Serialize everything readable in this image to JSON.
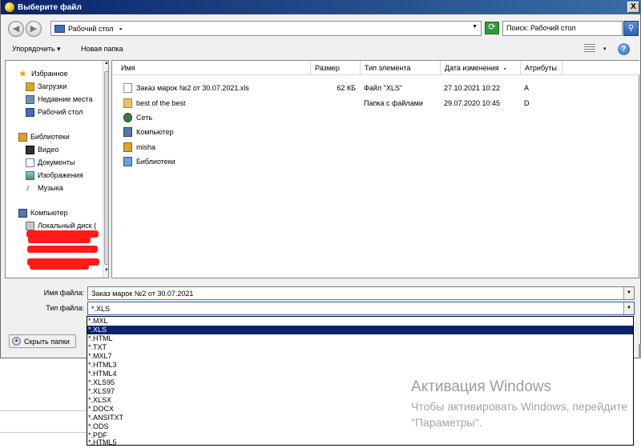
{
  "window": {
    "title": "Выберите файл",
    "close_label": "X"
  },
  "address": {
    "location": "Рабочий стол",
    "arrow": "▸",
    "search_placeholder": "Поиск: Рабочий стол"
  },
  "toolbar": {
    "organize_label": "Упорядочить ▾",
    "new_folder_label": "Новая папка",
    "view_drop": "▾",
    "help": "?"
  },
  "nav": {
    "favorites": "Избранное",
    "downloads": "Загрузки",
    "recent": "Недавние места",
    "desktop": "Рабочий стол",
    "libraries": "Библиотеки",
    "video": "Видео",
    "documents": "Документы",
    "images": "Изображения",
    "music": "Музыка",
    "computer": "Компьютер",
    "local_disk": "Локальный диск ("
  },
  "columns": {
    "name": "Имя",
    "size": "Размер",
    "type": "Тип элемента",
    "date": "Дата изменения",
    "attr": "Атрибуты",
    "sort_indicator": "▾"
  },
  "files": [
    {
      "name": "Заказ марок №2 от 30.07.2021.xls",
      "size": "62 КБ",
      "type": "Файл \"XLS\"",
      "date": "27.10.2021 10:22",
      "attr": "A",
      "icon": "xls-file-icon"
    },
    {
      "name": "best of the best",
      "size": "",
      "type": "Папка с файлами",
      "date": "29.07.2020 10:45",
      "attr": "D",
      "icon": "folder-icon"
    },
    {
      "name": "Сеть",
      "size": "",
      "type": "",
      "date": "",
      "attr": "",
      "icon": "network-icon"
    },
    {
      "name": "Компьютер",
      "size": "",
      "type": "",
      "date": "",
      "attr": "",
      "icon": "computer-icon"
    },
    {
      "name": "misha",
      "size": "",
      "type": "",
      "date": "",
      "attr": "",
      "icon": "user-folder-icon"
    },
    {
      "name": "Библиотеки",
      "size": "",
      "type": "",
      "date": "",
      "attr": "",
      "icon": "library-icon"
    }
  ],
  "bottom": {
    "file_name_label": "Имя файла:",
    "file_name_value": "Заказ марок №2 от 30.07.2021",
    "file_type_label": "Тип файла:",
    "file_type_value": "*.XLS",
    "hide_folders_label": "Скрыть папки"
  },
  "file_types": [
    "*.MXL",
    "*.XLS",
    "*.HTML",
    "*.TXT",
    "*.MXL7",
    "*.HTML3",
    "*.HTML4",
    "*.XLS95",
    "*.XLS97",
    "*.XLSX",
    "*.DOCX",
    "*.ANSITXT",
    "*.ODS",
    "*.PDF",
    "*.HTML5"
  ],
  "selected_file_type_index": 1,
  "watermark": {
    "line1": "Активация Windows",
    "line2": "Чтобы активировать Windows, перейдите",
    "line3": "\"Параметры\"."
  },
  "colors": {
    "titlebar": "#0a246a",
    "selection": "#0a246a",
    "redaction": "#ff1a1a"
  }
}
